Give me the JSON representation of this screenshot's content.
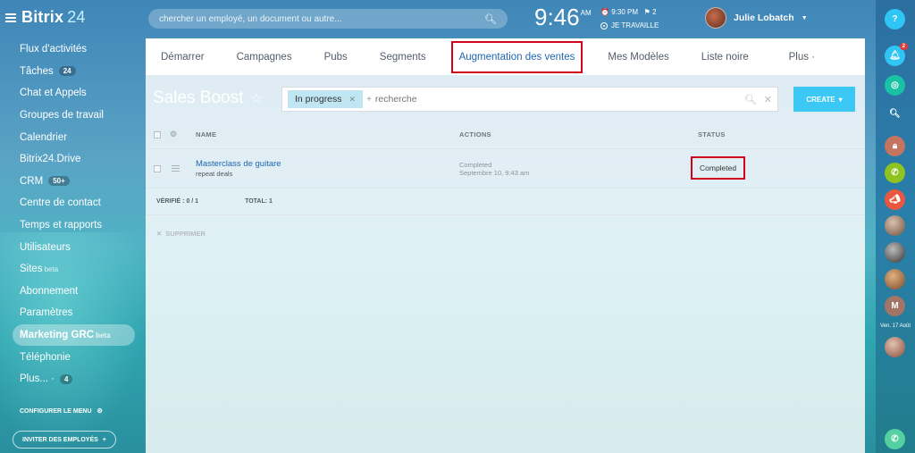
{
  "app": {
    "brand": "Bitrix",
    "brand_suffix": "24"
  },
  "sidebar": {
    "items": [
      {
        "label": "Flux d'activités",
        "badge": ""
      },
      {
        "label": "Tâches",
        "badge": "24"
      },
      {
        "label": "Chat et Appels",
        "badge": ""
      },
      {
        "label": "Groupes de travail",
        "badge": ""
      },
      {
        "label": "Calendrier",
        "badge": ""
      },
      {
        "label": "Bitrix24.Drive",
        "badge": ""
      },
      {
        "label": "CRM",
        "badge": "50+"
      },
      {
        "label": "Centre de contact",
        "badge": ""
      },
      {
        "label": "Temps et rapports",
        "badge": ""
      },
      {
        "label": "Utilisateurs",
        "badge": ""
      },
      {
        "label": "Sites",
        "sup": "beta"
      },
      {
        "label": "Abonnement",
        "badge": ""
      },
      {
        "label": "Paramètres",
        "badge": ""
      },
      {
        "label": "Marketing GRC",
        "sup": "beta",
        "active": true
      },
      {
        "label": "Téléphonie",
        "badge": ""
      },
      {
        "label": "Plus... ·",
        "badge": "4"
      }
    ],
    "config_label": "CONFIGURER LE MENU",
    "invite_label": "INVITER DES EMPLOYÉS"
  },
  "header": {
    "search_placeholder": "chercher un employé, un document ou autre...",
    "time": "9:46",
    "ampm": "AM",
    "alarm": "9:30 PM",
    "flags": "2",
    "work_status": "JE TRAVAILLE",
    "user_name": "Julie Lobatch"
  },
  "tabs": [
    "Démarrer",
    "Campagnes",
    "Pubs",
    "Segments",
    "Augmentation des ventes",
    "Mes Modèles",
    "Liste noire"
  ],
  "tab_more": "Plus ·",
  "page": {
    "title": "Sales Boost"
  },
  "filter": {
    "chip": "In progress",
    "placeholder": "recherche"
  },
  "create_label": "CREATE",
  "grid": {
    "headers": {
      "name": "NAME",
      "actions": "ACTIONS",
      "status": "STATUS"
    },
    "rows": [
      {
        "name": "Masterclass de guitare",
        "sub": "repeat deals",
        "action": "Completed",
        "action_date": "Septembre 10, 9:43 am",
        "status": "Completed"
      }
    ],
    "footer": {
      "verified": "VÉRIFIÉ : 0 / 1",
      "total": "TOTAL: 1"
    },
    "delete_label": "SUPPRIMER"
  },
  "rightbar": {
    "badge": "2",
    "date": "Ven. 17 Août",
    "avatar_letter": "M"
  }
}
